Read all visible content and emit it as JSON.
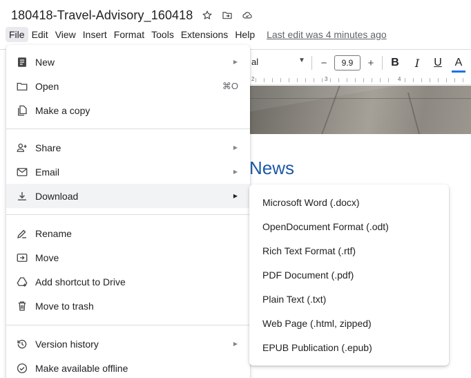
{
  "document": {
    "title": "180418-Travel-Advisory_160418",
    "heading": "News"
  },
  "menubar": {
    "items": [
      "File",
      "Edit",
      "View",
      "Insert",
      "Format",
      "Tools",
      "Extensions",
      "Help"
    ],
    "last_edit": "Last edit was 4 minutes ago"
  },
  "toolbar": {
    "font_name_visible": "al",
    "font_size": "9.9",
    "decrease": "−",
    "increase": "+",
    "bold": "B",
    "italic": "I",
    "underline": "U",
    "text_color": "A"
  },
  "ruler": {
    "marks": [
      "2",
      "3",
      "4"
    ]
  },
  "file_menu": {
    "items": [
      {
        "label": "New",
        "icon": "document-icon",
        "submenu": true
      },
      {
        "label": "Open",
        "icon": "folder-icon",
        "shortcut": "⌘O"
      },
      {
        "label": "Make a copy",
        "icon": "copy-icon"
      },
      {
        "label": "Share",
        "icon": "person-add-icon",
        "submenu": true
      },
      {
        "label": "Email",
        "icon": "email-icon",
        "submenu": true
      },
      {
        "label": "Download",
        "icon": "download-icon",
        "submenu": true,
        "active": true
      },
      {
        "label": "Rename",
        "icon": "rename-icon"
      },
      {
        "label": "Move",
        "icon": "move-icon"
      },
      {
        "label": "Add shortcut to Drive",
        "icon": "drive-shortcut-icon"
      },
      {
        "label": "Move to trash",
        "icon": "trash-icon"
      },
      {
        "label": "Version history",
        "icon": "history-icon",
        "submenu": true
      },
      {
        "label": "Make available offline",
        "icon": "offline-icon"
      }
    ]
  },
  "download_menu": {
    "items": [
      "Microsoft Word (.docx)",
      "OpenDocument Format (.odt)",
      "Rich Text Format (.rtf)",
      "PDF Document (.pdf)",
      "Plain Text (.txt)",
      "Web Page (.html, zipped)",
      "EPUB Publication (.epub)"
    ]
  },
  "colors": {
    "accent": "#1a73e8",
    "heading": "#1c5aa6",
    "menu_active_bg": "#e8eaed",
    "hover_bg": "#f1f3f4"
  }
}
